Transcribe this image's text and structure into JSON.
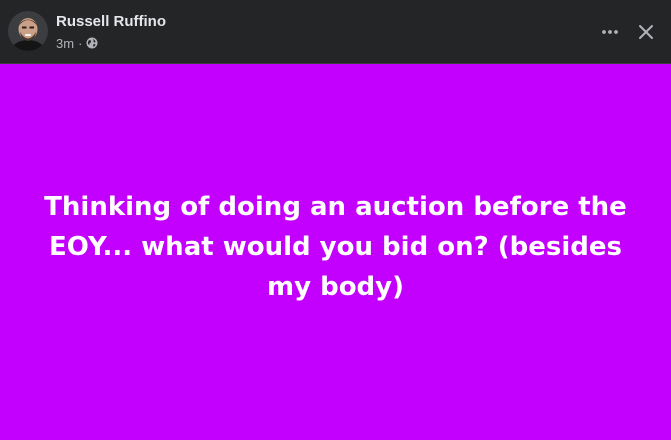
{
  "header": {
    "author_name": "Russell Ruffino",
    "timestamp": "3m",
    "separator": "·",
    "privacy_icon": "globe-icon",
    "more_icon": "more-horizontal-icon",
    "close_icon": "close-icon"
  },
  "post": {
    "text": "Thinking of doing an auction before the EOY... what would you bid on? (besides my body)",
    "background_color": "#c300fe",
    "text_color": "#ffffff"
  },
  "colors": {
    "header_bg": "#242526",
    "name_text": "#e4e6eb",
    "meta_text": "#b0b3b8"
  }
}
